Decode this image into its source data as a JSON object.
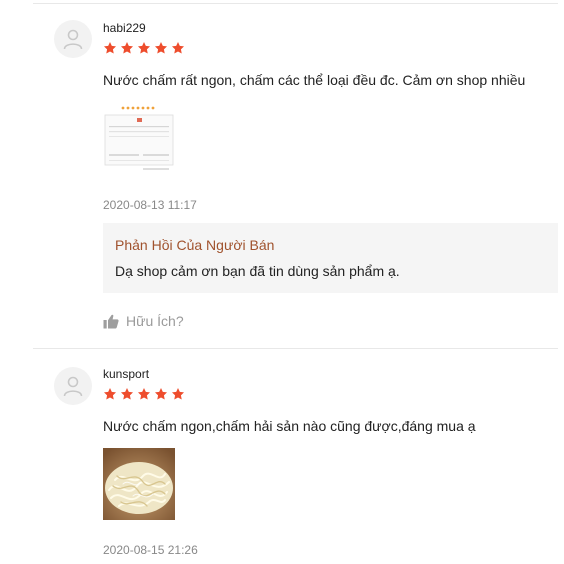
{
  "reviews": [
    {
      "username": "habi229",
      "rating": 5,
      "comment": "Nước chấm rất ngon, chấm các thể loại đều đc. Cảm ơn shop nhiều",
      "date": "2020-08-13 11:17",
      "seller_reply": {
        "title": "Phản Hồi Của Người Bán",
        "text": "Dạ shop cảm ơn bạn đã tin dùng sản phẩm ạ."
      },
      "helpful_label": "Hữu Ích?"
    },
    {
      "username": "kunsport",
      "rating": 5,
      "comment": "Nước chấm ngon,chấm hải sản nào cũng được,đáng mua ạ",
      "date": "2020-08-15 21:26"
    }
  ],
  "colors": {
    "star": "#ee4d2d",
    "reply_title": "#a0522d",
    "reply_bg": "#f5f5f5",
    "meta_text": "#888888"
  },
  "icons": {
    "avatar": "user-silhouette-icon",
    "star": "star-icon",
    "helpful": "thumbs-up-icon"
  }
}
